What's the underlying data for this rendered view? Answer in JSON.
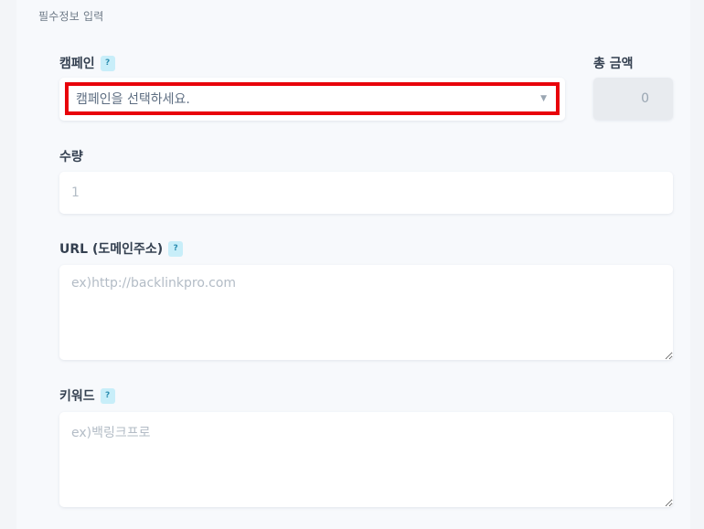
{
  "section": {
    "title": "필수정보 입력"
  },
  "campaign": {
    "label": "캠페인",
    "help": "?",
    "selected": "캠페인을 선택하세요.",
    "arrow": "▼"
  },
  "total": {
    "label": "총 금액",
    "value": "0"
  },
  "quantity": {
    "label": "수량",
    "placeholder": "1"
  },
  "url": {
    "label": "URL (도메인주소)",
    "help": "?",
    "placeholder": "ex)http://backlinkpro.com"
  },
  "keyword": {
    "label": "키워드",
    "help": "?",
    "placeholder": "ex)백링크프로"
  },
  "colors": {
    "highlight": "#e8020a",
    "help_bg": "#c8eef9",
    "help_fg": "#2b8db0"
  }
}
